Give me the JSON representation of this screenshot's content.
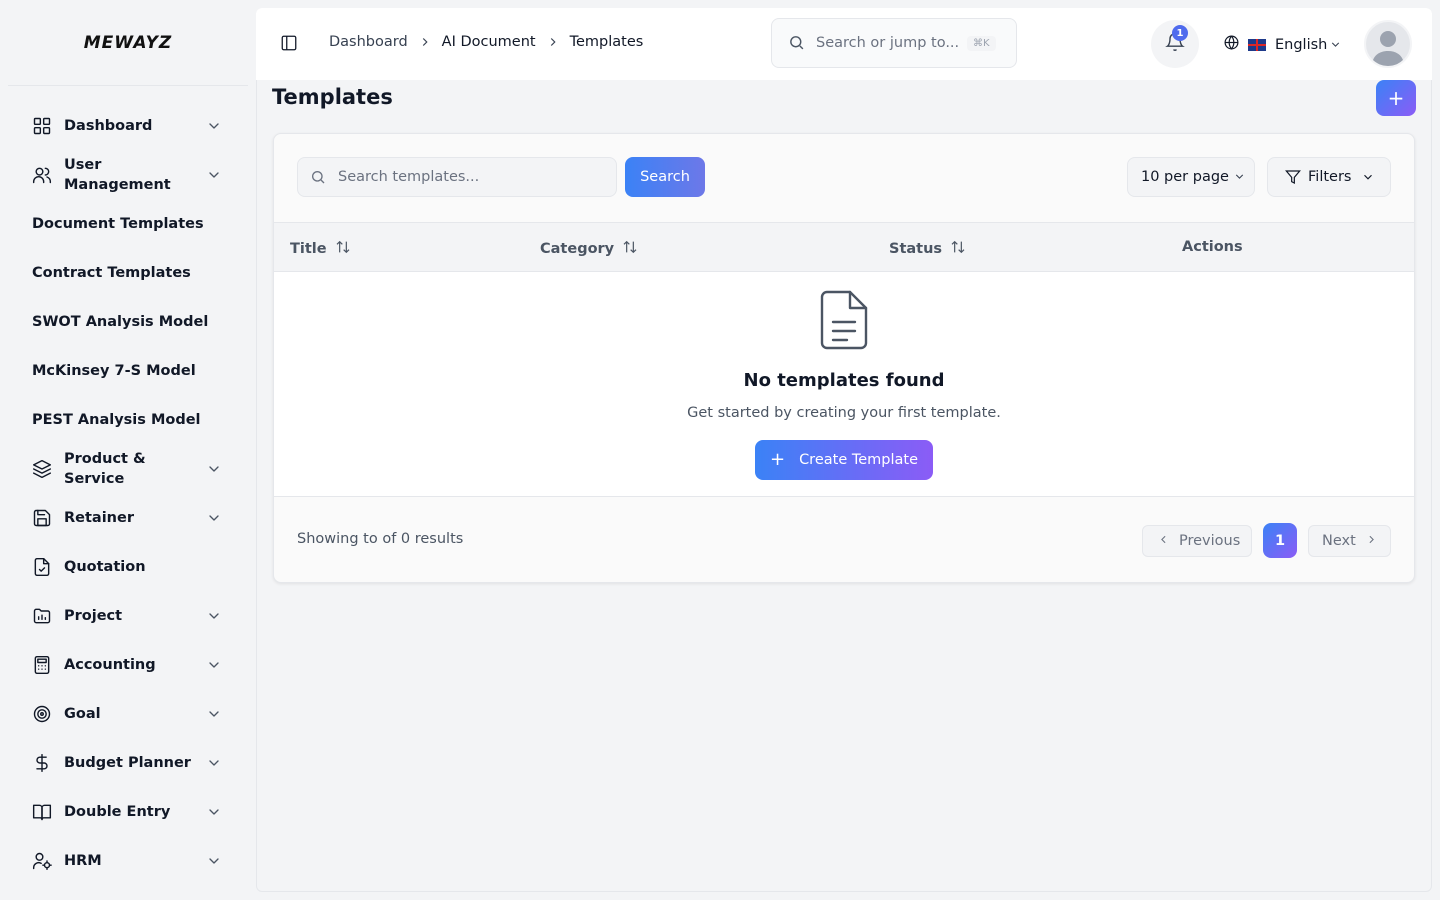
{
  "sidebar": {
    "logo": "MEWAYZ",
    "items": [
      {
        "label": "Dashboard",
        "icon": "grid-icon",
        "expandable": true
      },
      {
        "label": "User Management",
        "icon": "users-icon",
        "expandable": true
      },
      {
        "label": "Document Templates",
        "icon": "",
        "expandable": false
      },
      {
        "label": "Contract Templates",
        "icon": "",
        "expandable": false
      },
      {
        "label": "SWOT Analysis Model",
        "icon": "",
        "expandable": false
      },
      {
        "label": "McKinsey 7-S Model",
        "icon": "",
        "expandable": false
      },
      {
        "label": "PEST Analysis Model",
        "icon": "",
        "expandable": false
      },
      {
        "label": "Product & Service",
        "icon": "layers-icon",
        "expandable": true
      },
      {
        "label": "Retainer",
        "icon": "save-icon",
        "expandable": true
      },
      {
        "label": "Quotation",
        "icon": "file-check-icon",
        "expandable": false
      },
      {
        "label": "Project",
        "icon": "folder-chart-icon",
        "expandable": true
      },
      {
        "label": "Accounting",
        "icon": "calculator-icon",
        "expandable": true
      },
      {
        "label": "Goal",
        "icon": "target-icon",
        "expandable": true
      },
      {
        "label": "Budget Planner",
        "icon": "dollar-icon",
        "expandable": true
      },
      {
        "label": "Double Entry",
        "icon": "book-icon",
        "expandable": true
      },
      {
        "label": "HRM",
        "icon": "user-cog-icon",
        "expandable": true
      }
    ]
  },
  "header": {
    "breadcrumb": [
      "Dashboard",
      "AI Document",
      "Templates"
    ],
    "search_placeholder": "Search or jump to...",
    "search_shortcut": "⌘K",
    "notification_count": "1",
    "language": "English"
  },
  "page": {
    "title": "Templates",
    "add_label": "+"
  },
  "toolbar": {
    "search_placeholder": "Search templates...",
    "search_button": "Search",
    "per_page": "10 per page",
    "filters": "Filters"
  },
  "table": {
    "columns": [
      "Title",
      "Category",
      "Status",
      "Actions"
    ],
    "rows": []
  },
  "empty_state": {
    "title": "No templates found",
    "subtitle": "Get started by creating your first template.",
    "button": "Create Template"
  },
  "pagination": {
    "summary": "Showing to of 0 results",
    "previous": "Previous",
    "current_page": "1",
    "next": "Next"
  },
  "colors": {
    "accent_start": "#3b82f6",
    "accent_end": "#8b5cf6",
    "background": "#f3f4f6"
  }
}
